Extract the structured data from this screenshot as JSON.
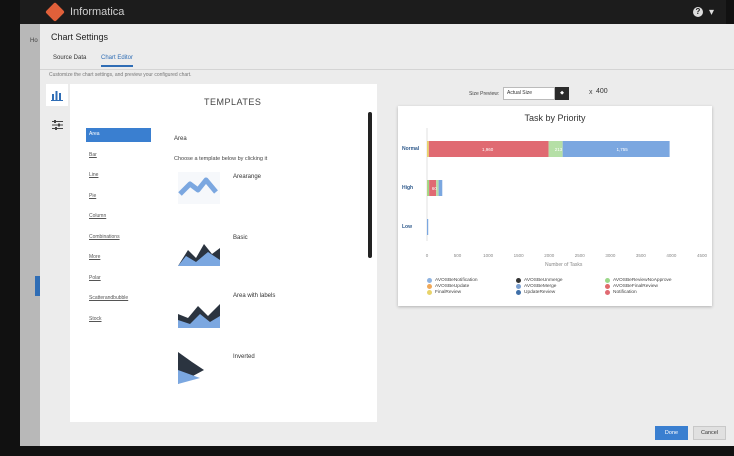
{
  "app": {
    "name": "Informatica"
  },
  "topbar": {
    "help_label": "?",
    "caret": "▾"
  },
  "background": {
    "left_tab_label": "Ho"
  },
  "modal": {
    "title": "Chart Settings",
    "tabs": [
      {
        "label": "Source Data",
        "active": false
      },
      {
        "label": "Chart Editor",
        "active": true
      }
    ],
    "description": "Customize the chart settings, and preview your configured chart.",
    "side_icons": [
      "bar-chart-icon",
      "sliders-icon"
    ]
  },
  "templates": {
    "heading": "TEMPLATES",
    "items": [
      "Area",
      "Bar",
      "Line",
      "Pie",
      "Column",
      "Combinations",
      "More",
      "Polar",
      "Scatterandbubble",
      "Stock"
    ],
    "selected": "Area",
    "hint": "Choose a template below by clicking it",
    "thumbnails": [
      {
        "label": "Arearange"
      },
      {
        "label": "Basic"
      },
      {
        "label": "Area with labels"
      },
      {
        "label": "Inverted"
      }
    ]
  },
  "preview": {
    "size_label": "Size Preview:",
    "size_value": "Actual Size",
    "size_x": "x",
    "height": "400"
  },
  "chart_data": {
    "type": "bar",
    "stacked": true,
    "orientation": "horizontal",
    "title": "Task by Priority",
    "xlabel": "Number of Tasks",
    "categories": [
      "Normal",
      "High",
      "Low"
    ],
    "xlim": [
      0,
      4500
    ],
    "xticks": [
      0,
      500,
      1000,
      1500,
      2000,
      2500,
      3000,
      3500,
      4000,
      4500
    ],
    "series": [
      {
        "name": "AVOSBeNotification",
        "color": "#8fb3e0",
        "values": [
          0,
          0,
          0
        ]
      },
      {
        "name": "AVOSBeUpdate",
        "color": "#f0a95a",
        "values": [
          0,
          0,
          0
        ]
      },
      {
        "name": "FinalReview",
        "color": "#e8d36a",
        "values": [
          30,
          5,
          0
        ]
      },
      {
        "name": "AVOSBeUnmerge",
        "color": "#333333",
        "values": [
          0,
          0,
          0
        ]
      },
      {
        "name": "AVOSBeMerge",
        "color": "#7a9fd0",
        "values": [
          0,
          0,
          0
        ]
      },
      {
        "name": "UpdateReview",
        "color": "#3f6fa8",
        "values": [
          0,
          0,
          0
        ]
      },
      {
        "name": "AVOSBeReviewNoApprove",
        "color": "#9bd88a",
        "values": [
          0,
          30,
          0
        ]
      },
      {
        "name": "AVOSBeFinalReview",
        "color": "#e06a6a",
        "values": [
          0,
          0,
          0
        ]
      },
      {
        "name": "Notification",
        "color": "#e06a72",
        "values": [
          1960,
          115,
          0
        ]
      },
      {
        "name": "",
        "color": "#b5dfa6",
        "values": [
          230,
          40,
          0
        ]
      },
      {
        "name": "",
        "color": "#7ba7e0",
        "values": [
          1750,
          60,
          20
        ]
      }
    ],
    "data_labels": [
      "1,960",
      "213",
      "1,755",
      "60"
    ]
  },
  "buttons": {
    "done": "Done",
    "cancel": "Cancel"
  }
}
